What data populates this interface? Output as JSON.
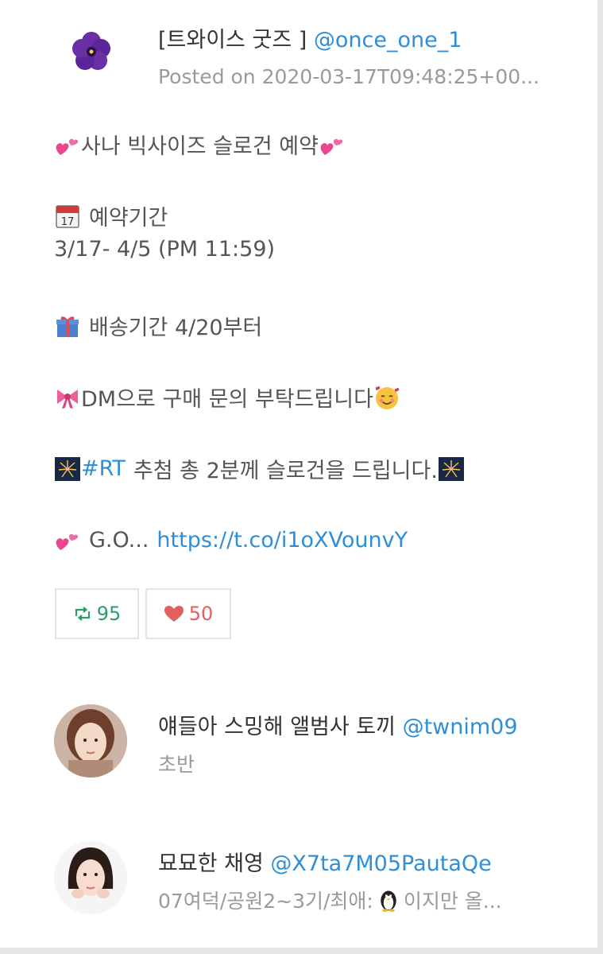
{
  "post": {
    "author_name": "[트와이스 굿즈 ]",
    "author_handle": "@once_one_1",
    "posted": "Posted on 2020-03-17T09:48:25+00...",
    "lines": {
      "title": "사나 빅사이즈 슬로건 예약",
      "period_label": "예약기간",
      "period_value": "3/17- 4/5 (PM 11:59)",
      "shipping": "배송기간 4/20부터",
      "dm": "DM으로 구매 문의 부탁드립니다",
      "rt_tag": "#RT",
      "rt_text": "추첨 총 2분께 슬로건을 드립니다.",
      "go_prefix": "G.O...",
      "link": "https://t.co/i1oXVounvY"
    },
    "retweets": "95",
    "likes": "50"
  },
  "replies": [
    {
      "name": "얘들아 스밍해 앨범사 토끼",
      "handle": "@twnim09",
      "bio": "초반"
    },
    {
      "name": "묘묘한 채영",
      "handle": "@X7ta7M05PautaQe",
      "bio_before": "07여덕/공원2~3기/최애:",
      "bio_after": "이지만 올..."
    }
  ],
  "icons": {
    "avatar": "purple-flower-icon",
    "heart": "two-hearts-icon",
    "calendar": "calendar-icon",
    "gift": "gift-icon",
    "ribbon": "ribbon-icon",
    "smile": "smiling-face-with-hearts-icon",
    "fireworks": "fireworks-icon",
    "retweet": "retweet-icon",
    "like": "heart-icon",
    "penguin": "penguin-icon"
  },
  "colors": {
    "link": "#2e8fd8",
    "retweet": "#26a269",
    "like": "#e06060",
    "muted": "#9a9a9a"
  }
}
